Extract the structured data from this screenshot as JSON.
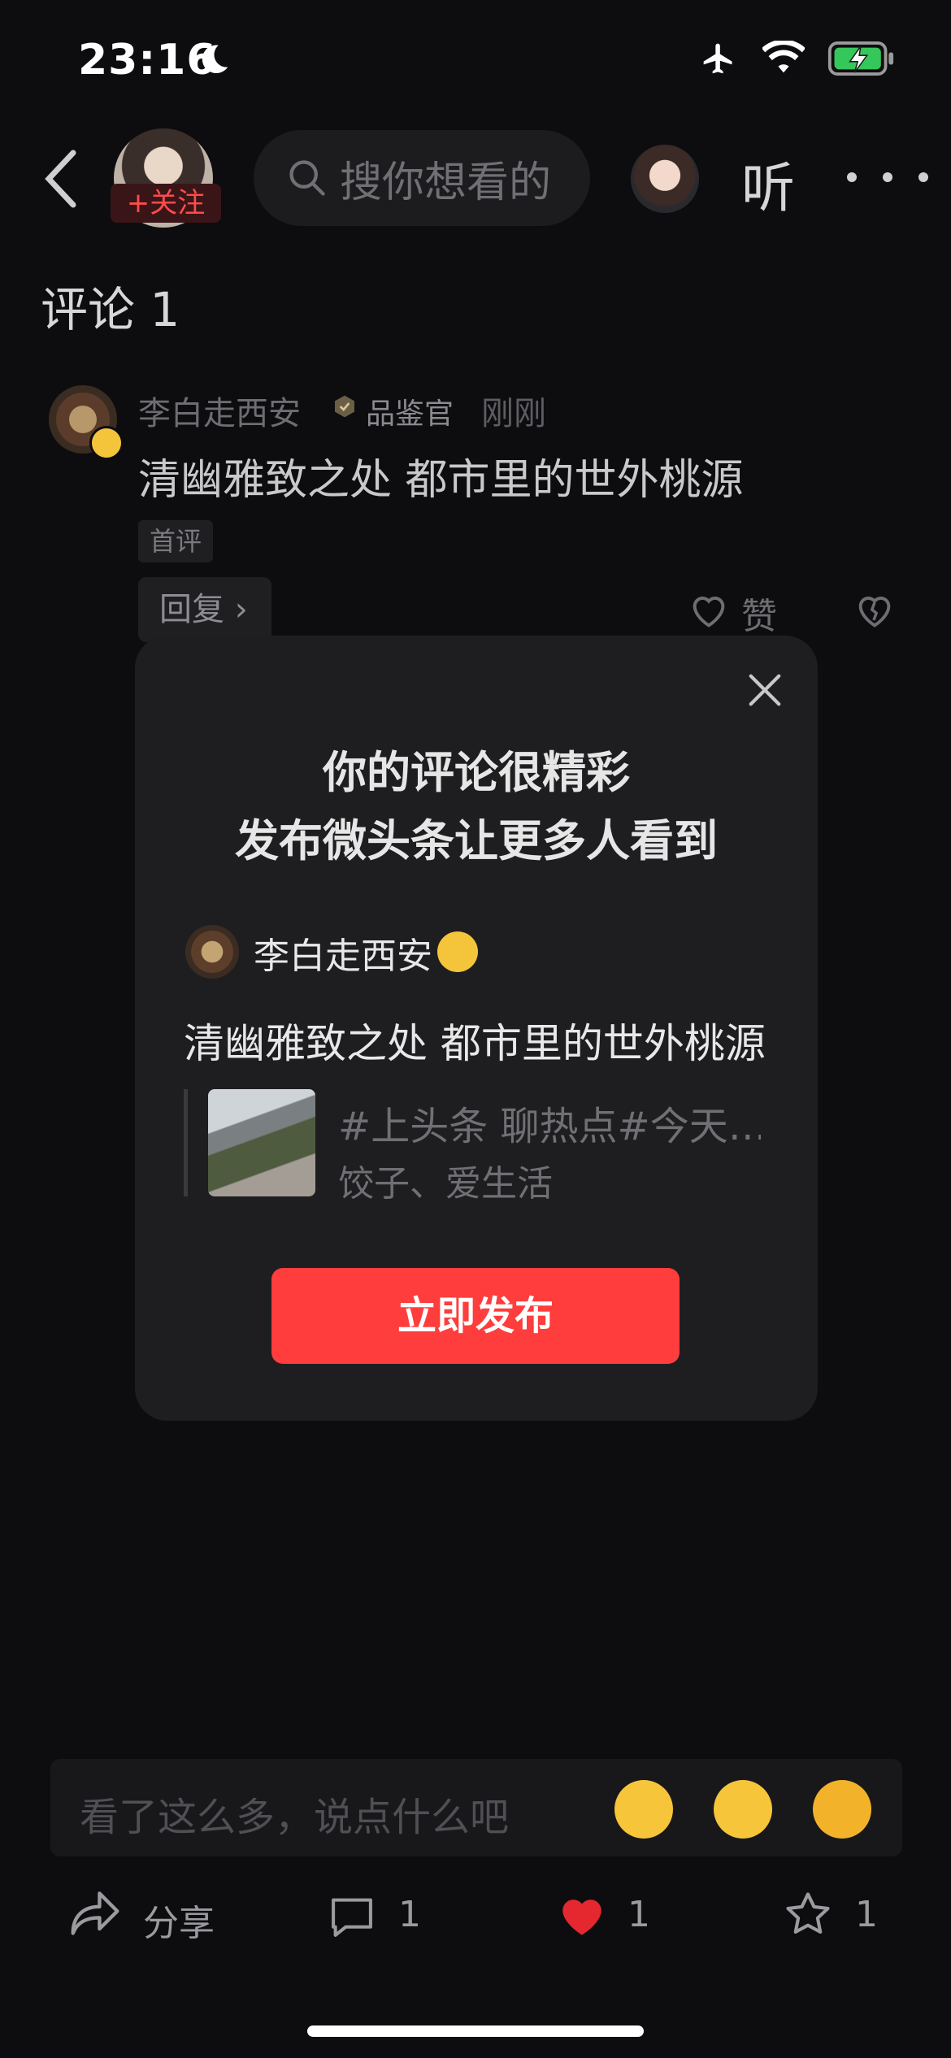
{
  "status_bar": {
    "time": "23:16"
  },
  "header": {
    "follow_label": "+关注",
    "search_placeholder": "搜你想看的",
    "listen_label": "听"
  },
  "comments": {
    "title": "评论 1",
    "items": [
      {
        "user": "李白走西安",
        "role": "品鉴官",
        "time": "刚刚",
        "text": "清幽雅致之处 都市里的世外桃源",
        "tag": "首评",
        "reply_label": "回复",
        "like_label": "赞"
      }
    ]
  },
  "modal": {
    "title_line1": "你的评论很精彩",
    "title_line2": "发布微头条让更多人看到",
    "user": "李白走西安",
    "text": "清幽雅致之处 都市里的世外桃源",
    "quote_line1": "#上头条 聊热点#今天…",
    "quote_line2": "饺子、爱生活",
    "publish_label": "立即发布"
  },
  "input": {
    "placeholder": "看了这么多，说点什么吧"
  },
  "bottom_bar": {
    "share_label": "分享",
    "comment_count": "1",
    "like_count": "1",
    "favorite_count": "1"
  },
  "colors": {
    "accent": "#fe3d3c",
    "like_red": "#e5282f",
    "badge_gold": "#f4c43a"
  },
  "icons": [
    "moon-icon",
    "airplane-icon",
    "wifi-icon",
    "battery-charging-icon",
    "back-icon",
    "search-icon",
    "more-icon",
    "close-icon",
    "heart-icon",
    "dislike-icon",
    "share-icon",
    "comment-icon",
    "star-icon"
  ]
}
